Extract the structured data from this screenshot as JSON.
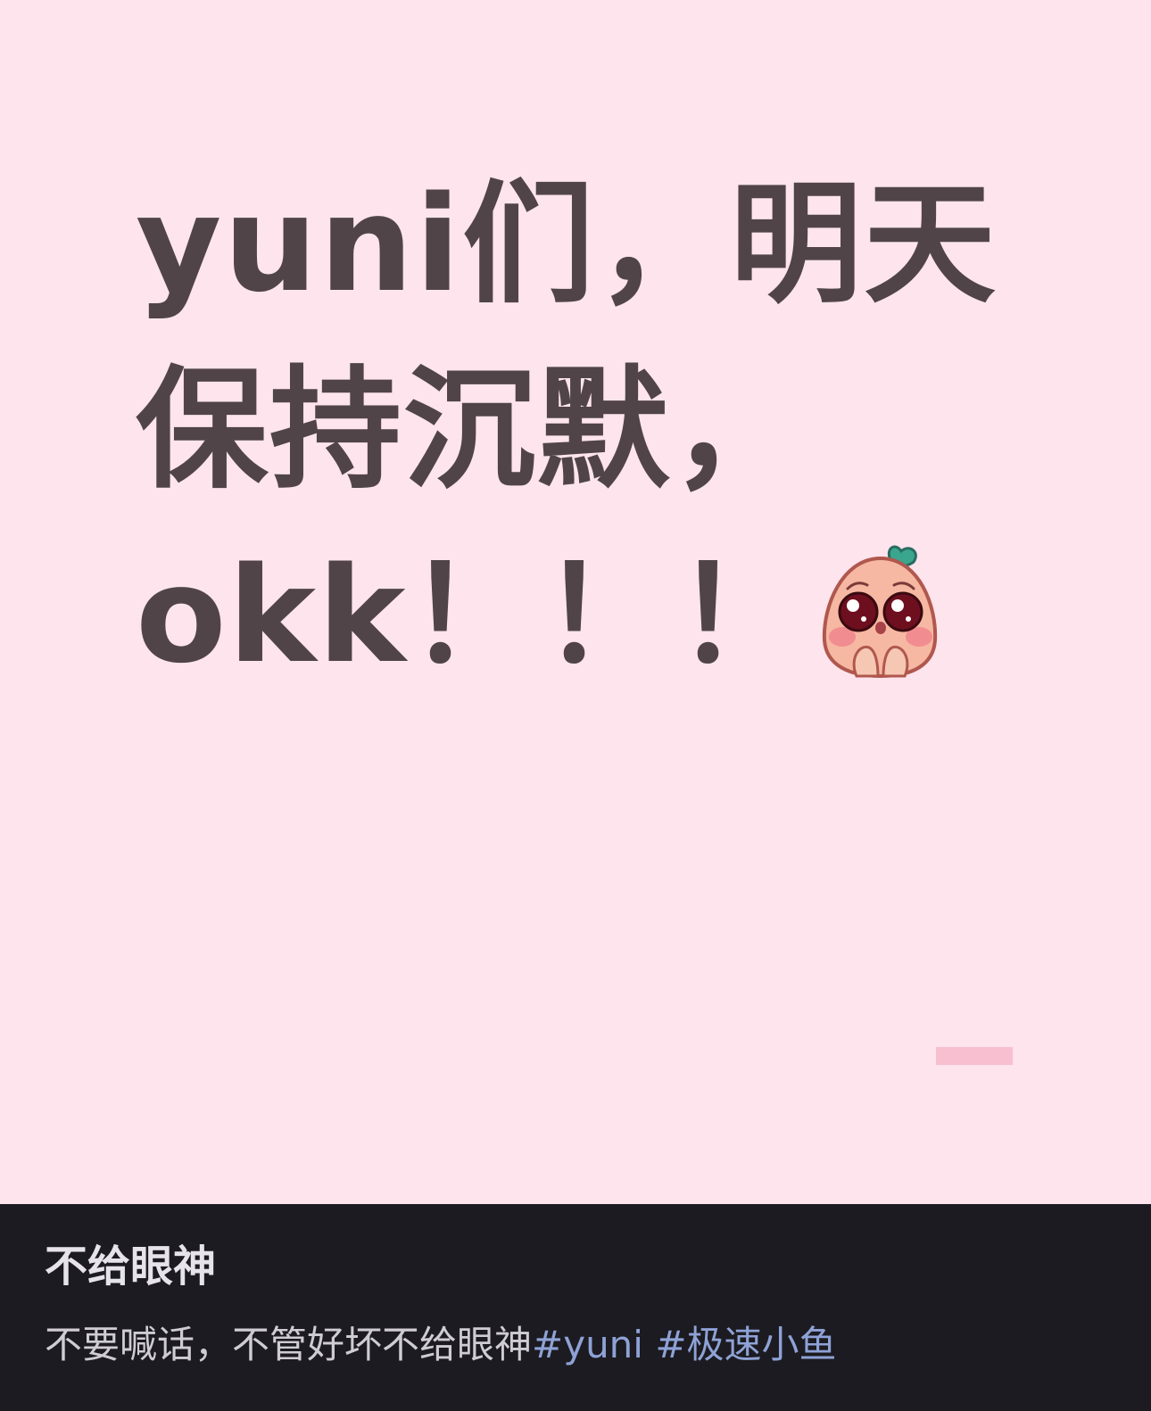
{
  "post": {
    "image": {
      "lines": [
        "yuni们，明天",
        "保持沉默，",
        "okk！！！"
      ],
      "background_color": "#fde4ed",
      "text_color": "#504448",
      "sticker_icon": "pleading-peach-face"
    },
    "title": "不给眼神",
    "description": "不要喊话，不管好坏不给眼神",
    "hashtags": [
      "#yuni",
      " #极速小鱼"
    ],
    "hashtag_color": "#8ea2d6"
  }
}
